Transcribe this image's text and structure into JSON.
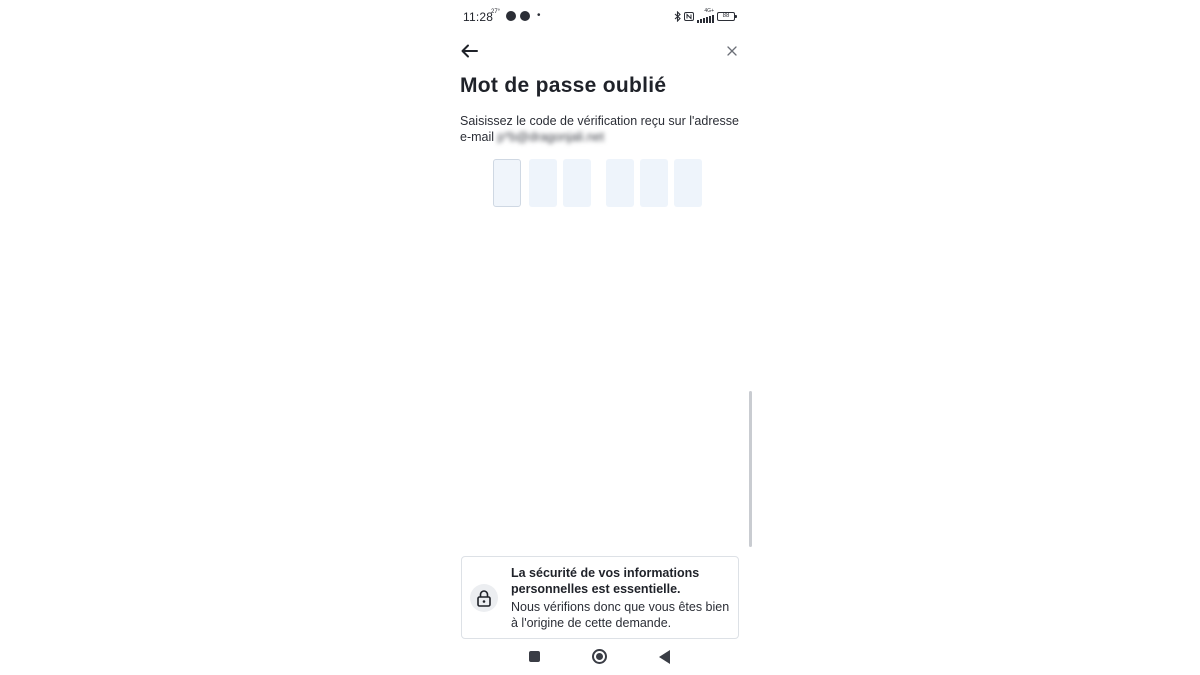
{
  "status_bar": {
    "time": "11:28",
    "temperature": "27°",
    "network": "4G+",
    "battery": "88",
    "icons": [
      "app-icon",
      "vpn-icon",
      "bluetooth-icon",
      "nfc-icon",
      "signal-icon",
      "battery-icon"
    ]
  },
  "header": {
    "back_icon": "arrow-left-icon",
    "close_icon": "close-icon"
  },
  "page": {
    "title": "Mot de passe oublié",
    "instructions": "Saisissez le code de vérification reçu sur l'adresse e-mail",
    "email_masked": "p*b@dragonjali.net"
  },
  "code_input": {
    "length": 6,
    "values": [
      "",
      "",
      "",
      "",
      "",
      ""
    ],
    "active_index": 0
  },
  "security_card": {
    "icon": "lock-icon",
    "title": "La sécurité de vos informations personnelles est essentielle.",
    "text": "Nous vérifions donc que vous êtes bien à l'origine de cette demande."
  },
  "nav_bar": {
    "icons": [
      "recent-apps-icon",
      "home-icon",
      "back-triangle-icon"
    ]
  },
  "colors": {
    "text": "#1f2229",
    "code_box_bg": "#eef4fb",
    "card_border": "#dde1e6"
  }
}
